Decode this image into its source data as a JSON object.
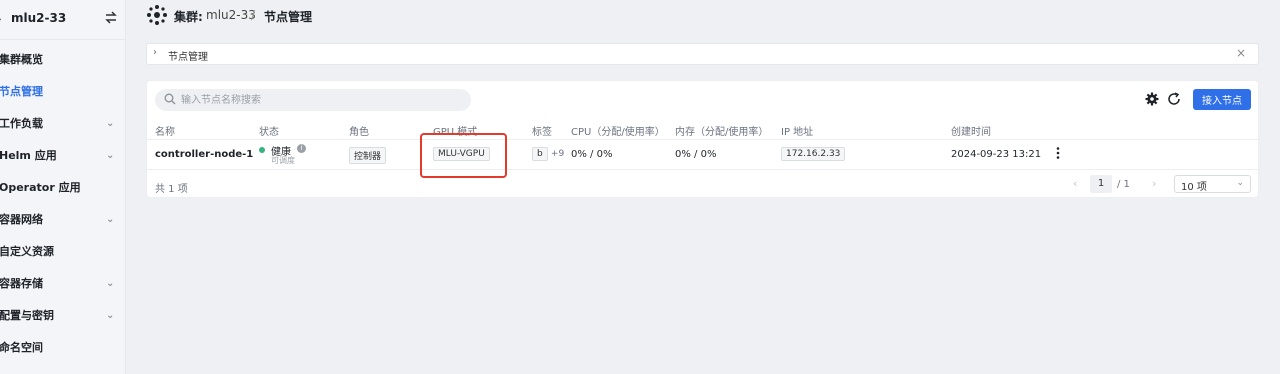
{
  "sidebar": {
    "cluster_name": "mlu2-33",
    "items": [
      {
        "label": "集群概览",
        "has_arrow": false,
        "active": false
      },
      {
        "label": "节点管理",
        "has_arrow": false,
        "active": true
      },
      {
        "label": "工作负载",
        "has_arrow": true,
        "active": false
      },
      {
        "label": "Helm 应用",
        "has_arrow": true,
        "active": false
      },
      {
        "label": "Operator 应用",
        "has_arrow": false,
        "active": false
      },
      {
        "label": "容器网络",
        "has_arrow": true,
        "active": false
      },
      {
        "label": "自定义资源",
        "has_arrow": false,
        "active": false
      },
      {
        "label": "容器存储",
        "has_arrow": true,
        "active": false
      },
      {
        "label": "配置与密钥",
        "has_arrow": true,
        "active": false
      },
      {
        "label": "命名空间",
        "has_arrow": false,
        "active": false
      }
    ]
  },
  "header": {
    "breadcrumb_cluster_label": "集群:",
    "breadcrumb_cluster_name": "mlu2-33",
    "separator": "/",
    "breadcrumb_current": "节点管理"
  },
  "collapse_panel": {
    "title": "节点管理"
  },
  "toolbar": {
    "search_placeholder": "输入节点名称搜索",
    "add_node_label": "接入节点",
    "gear_icon": "gear-icon",
    "refresh_icon": "refresh-icon"
  },
  "table": {
    "columns": [
      "名称",
      "状态",
      "角色",
      "GPU 模式",
      "标签",
      "CPU（分配/使用率）",
      "内存（分配/使用率）",
      "IP 地址",
      "创建时间"
    ],
    "rows": [
      {
        "name": "controller-node-1",
        "status": "健康",
        "status_sub": "可调度",
        "role": "控制器",
        "gpu_mode": "MLU-VGPU",
        "label_tag": "b",
        "label_more": "+9",
        "cpu": "0% / 0%",
        "memory": "0% / 0%",
        "ip": "172.16.2.33",
        "created": "2024-09-23 13:21"
      }
    ]
  },
  "footer": {
    "total": "共 1 项",
    "page_current": "1",
    "page_total": "/ 1",
    "page_size": "10 项"
  },
  "colors": {
    "accent": "#2f6fe8",
    "status_ok": "#36b37e",
    "highlight_box": "#e23b2e"
  }
}
